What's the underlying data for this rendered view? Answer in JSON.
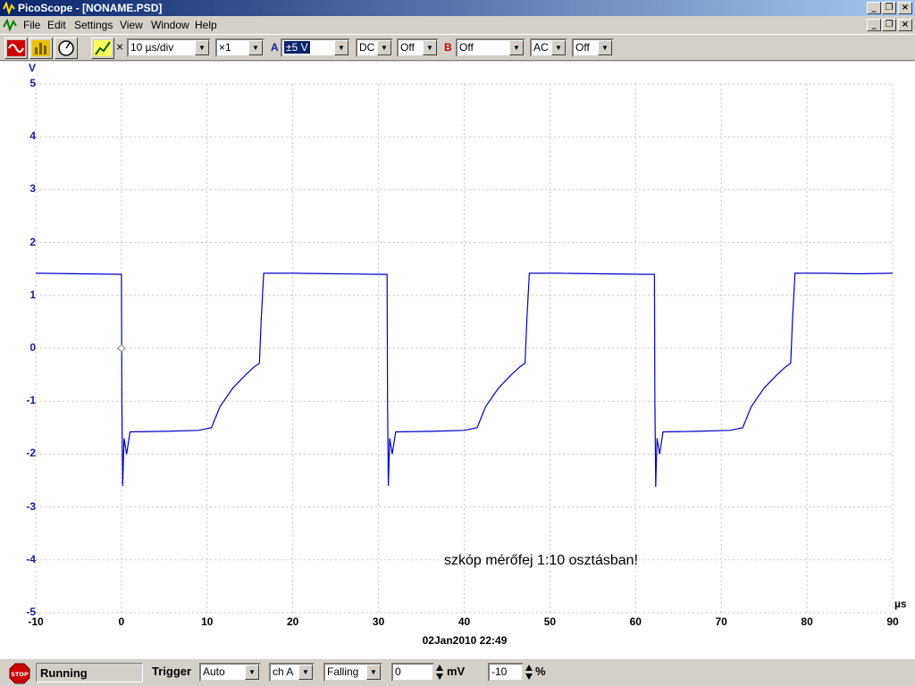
{
  "window": {
    "title": "PicoScope - [NONAME.PSD]",
    "minimize": "_",
    "restore": "❐",
    "close": "×"
  },
  "menu": [
    "File",
    "Edit",
    "Settings",
    "View",
    "Window",
    "Help"
  ],
  "toolbar": {
    "multiply_sign": "×",
    "timebase": "10 µs/div",
    "zoom": "×1",
    "channel_a_label": "A",
    "channel_a_range": "±5 V",
    "channel_a_coupling": "DC",
    "channel_a_offset": "Off",
    "channel_b_label": "B",
    "channel_b_range": "Off",
    "channel_b_coupling": "AC",
    "channel_b_offset": "Off"
  },
  "colors": {
    "channel_a": "#1a1aa0",
    "channel_b": "#cc0000",
    "trace": "#0000cc",
    "titlebar": "#0a246a"
  },
  "chart_data": {
    "type": "line",
    "xlabel": "µs",
    "ylabel": "V",
    "xlim": [
      -10,
      90
    ],
    "ylim": [
      -5,
      5
    ],
    "x_ticks": [
      "-10",
      "0",
      "10",
      "20",
      "30",
      "40",
      "50",
      "60",
      "70",
      "80",
      "90"
    ],
    "y_ticks": [
      "5",
      "4",
      "3",
      "2",
      "1",
      "0",
      "-1",
      "-2",
      "-3",
      "-4",
      "-5"
    ],
    "grid": true,
    "trigger_marker": {
      "x": 0,
      "y": 0
    },
    "series": [
      {
        "x": [
          -10,
          0,
          0.05,
          0.15,
          0.3,
          0.6,
          1,
          5,
          9,
          10.5,
          11.5,
          13,
          14.5,
          15.5,
          16.1,
          16.3,
          16.6,
          20,
          25,
          30,
          31,
          31.05,
          31.15,
          31.3,
          31.6,
          32,
          36,
          40,
          41.5,
          42.5,
          44,
          45.5,
          46.5,
          47.1,
          47.3,
          47.6,
          51,
          56,
          61,
          62.2,
          62.25,
          62.35,
          62.5,
          62.8,
          63.2,
          67,
          71,
          72.5,
          73.5,
          75,
          76.5,
          77.5,
          78.1,
          78.3,
          78.6,
          82,
          86,
          90
        ],
        "y": [
          1.42,
          1.4,
          -1.0,
          -2.6,
          -1.7,
          -2.0,
          -1.58,
          -1.57,
          -1.55,
          -1.5,
          -1.1,
          -0.75,
          -0.5,
          -0.35,
          -0.28,
          0.5,
          1.42,
          1.42,
          1.41,
          1.4,
          1.4,
          -1.0,
          -2.6,
          -1.7,
          -2.0,
          -1.58,
          -1.57,
          -1.55,
          -1.5,
          -1.1,
          -0.75,
          -0.5,
          -0.35,
          -0.28,
          0.5,
          1.42,
          1.42,
          1.41,
          1.4,
          1.4,
          -1.0,
          -2.62,
          -1.7,
          -2.0,
          -1.58,
          -1.57,
          -1.55,
          -1.5,
          -1.1,
          -0.75,
          -0.5,
          -0.35,
          -0.28,
          0.5,
          1.42,
          1.42,
          1.41,
          1.42
        ]
      }
    ]
  },
  "plot": {
    "timestamp": "02Jan2010  22:49",
    "annotation": "szkóp mérőfej 1:10  osztásban!"
  },
  "status": {
    "state": "Running",
    "trigger_label": "Trigger",
    "trigger_mode": "Auto",
    "trigger_channel": "ch A",
    "trigger_edge": "Falling",
    "trigger_level": "0",
    "trigger_level_unit": "mV",
    "pre_trigger": "-10",
    "pre_trigger_unit": "%",
    "stop_label": "STOP"
  }
}
